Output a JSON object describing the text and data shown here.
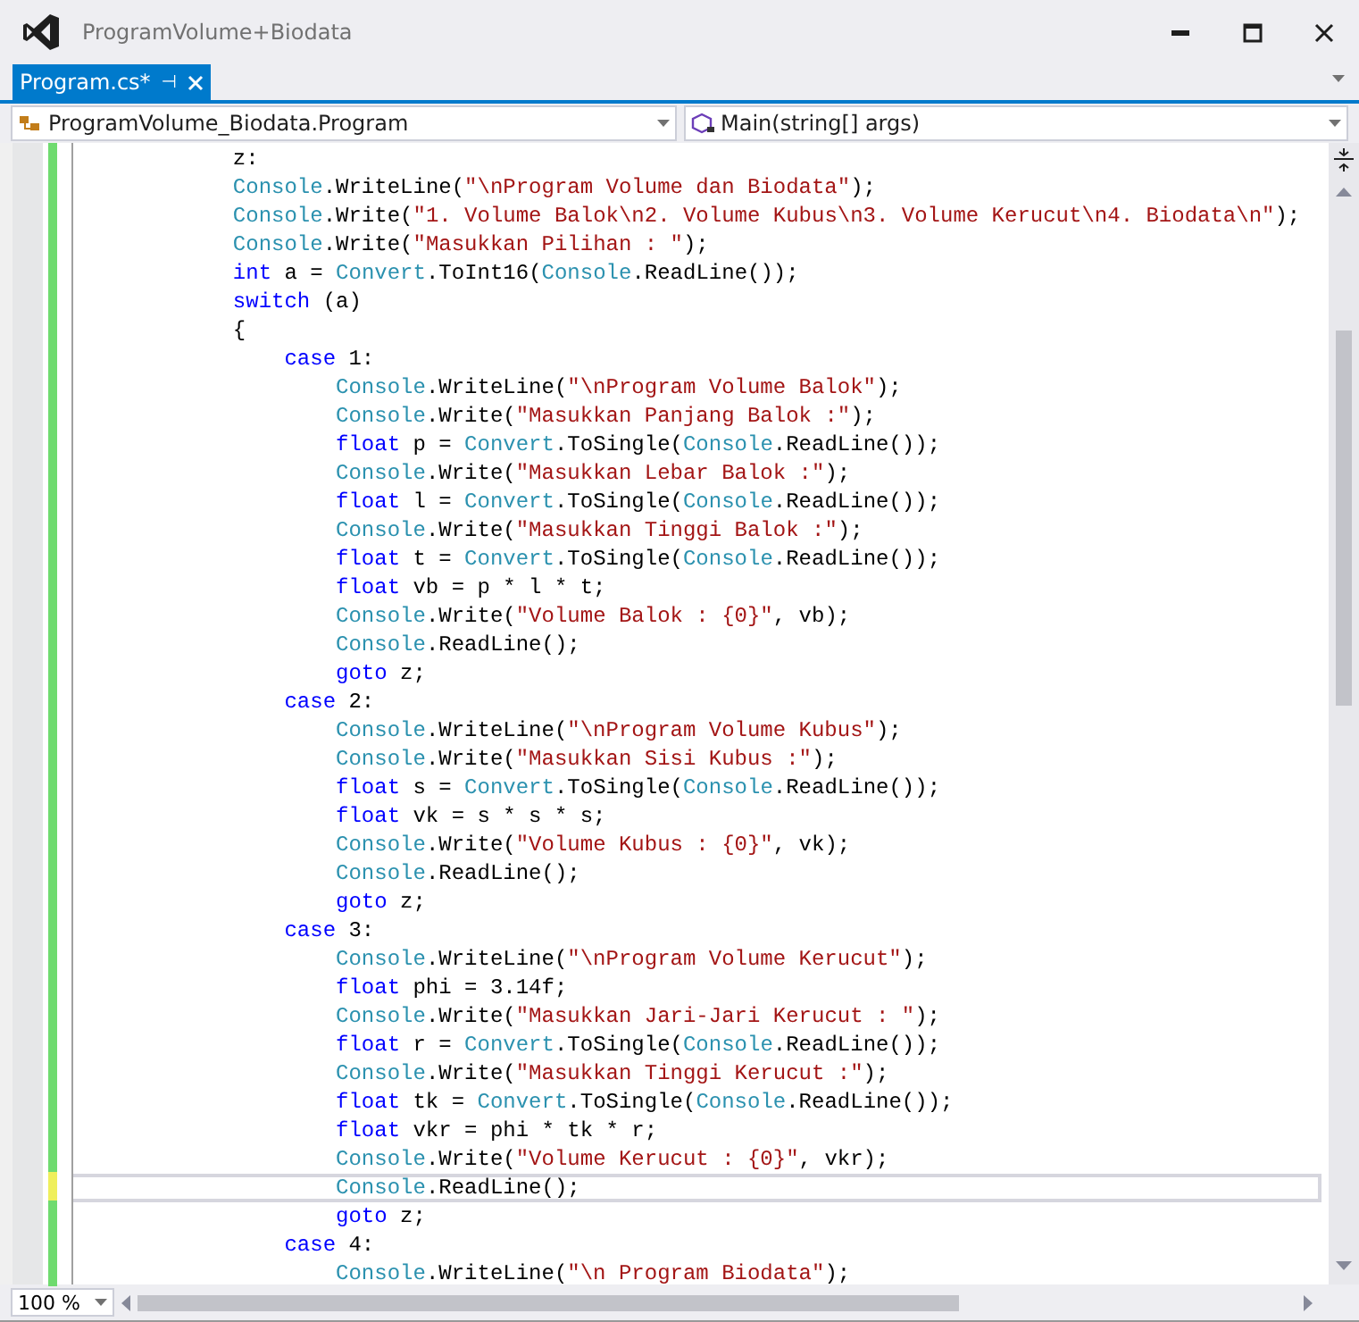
{
  "window": {
    "title": "ProgramVolume+Biodata"
  },
  "tabs": [
    {
      "label": "Program.cs*",
      "selected": true,
      "pin": "⊣"
    }
  ],
  "navigation": {
    "type_combo": "ProgramVolume_Biodata.Program",
    "member_combo": "Main(string[] args)"
  },
  "editor": {
    "lines": [
      {
        "saved": true,
        "current": false,
        "tokens": [
          {
            "kind": "plain",
            "text": "            z:"
          }
        ]
      },
      {
        "saved": true,
        "current": false,
        "tokens": [
          {
            "kind": "type",
            "text": "            Console"
          },
          {
            "kind": "plain",
            "text": ".WriteLine("
          },
          {
            "kind": "string",
            "text": "\"\\nProgram Volume dan Biodata\""
          },
          {
            "kind": "plain",
            "text": ");"
          }
        ]
      },
      {
        "saved": true,
        "current": false,
        "tokens": [
          {
            "kind": "type",
            "text": "            Console"
          },
          {
            "kind": "plain",
            "text": ".Write("
          },
          {
            "kind": "string",
            "text": "\"1. Volume Balok\\n2. Volume Kubus\\n3. Volume Kerucut\\n4. Biodata\\n\""
          },
          {
            "kind": "plain",
            "text": ");"
          }
        ]
      },
      {
        "saved": true,
        "current": false,
        "tokens": [
          {
            "kind": "type",
            "text": "            Console"
          },
          {
            "kind": "plain",
            "text": ".Write("
          },
          {
            "kind": "string",
            "text": "\"Masukkan Pilihan : \""
          },
          {
            "kind": "plain",
            "text": ");"
          }
        ]
      },
      {
        "saved": true,
        "current": false,
        "tokens": [
          {
            "kind": "keyword",
            "text": "            int"
          },
          {
            "kind": "plain",
            "text": " a = "
          },
          {
            "kind": "type",
            "text": "Convert"
          },
          {
            "kind": "plain",
            "text": ".ToInt16("
          },
          {
            "kind": "type",
            "text": "Console"
          },
          {
            "kind": "plain",
            "text": ".ReadLine());"
          }
        ]
      },
      {
        "saved": true,
        "current": false,
        "tokens": [
          {
            "kind": "keyword",
            "text": "            switch"
          },
          {
            "kind": "plain",
            "text": " (a)"
          }
        ]
      },
      {
        "saved": true,
        "current": false,
        "tokens": [
          {
            "kind": "plain",
            "text": "            {"
          }
        ]
      },
      {
        "saved": true,
        "current": false,
        "tokens": [
          {
            "kind": "keyword",
            "text": "                case"
          },
          {
            "kind": "plain",
            "text": " 1:"
          }
        ]
      },
      {
        "saved": true,
        "current": false,
        "tokens": [
          {
            "kind": "type",
            "text": "                    Console"
          },
          {
            "kind": "plain",
            "text": ".WriteLine("
          },
          {
            "kind": "string",
            "text": "\"\\nProgram Volume Balok\""
          },
          {
            "kind": "plain",
            "text": ");"
          }
        ]
      },
      {
        "saved": true,
        "current": false,
        "tokens": [
          {
            "kind": "type",
            "text": "                    Console"
          },
          {
            "kind": "plain",
            "text": ".Write("
          },
          {
            "kind": "string",
            "text": "\"Masukkan Panjang Balok :\""
          },
          {
            "kind": "plain",
            "text": ");"
          }
        ]
      },
      {
        "saved": true,
        "current": false,
        "tokens": [
          {
            "kind": "keyword",
            "text": "                    float"
          },
          {
            "kind": "plain",
            "text": " p = "
          },
          {
            "kind": "type",
            "text": "Convert"
          },
          {
            "kind": "plain",
            "text": ".ToSingle("
          },
          {
            "kind": "type",
            "text": "Console"
          },
          {
            "kind": "plain",
            "text": ".ReadLine());"
          }
        ]
      },
      {
        "saved": true,
        "current": false,
        "tokens": [
          {
            "kind": "type",
            "text": "                    Console"
          },
          {
            "kind": "plain",
            "text": ".Write("
          },
          {
            "kind": "string",
            "text": "\"Masukkan Lebar Balok :\""
          },
          {
            "kind": "plain",
            "text": ");"
          }
        ]
      },
      {
        "saved": true,
        "current": false,
        "tokens": [
          {
            "kind": "keyword",
            "text": "                    float"
          },
          {
            "kind": "plain",
            "text": " l = "
          },
          {
            "kind": "type",
            "text": "Convert"
          },
          {
            "kind": "plain",
            "text": ".ToSingle("
          },
          {
            "kind": "type",
            "text": "Console"
          },
          {
            "kind": "plain",
            "text": ".ReadLine());"
          }
        ]
      },
      {
        "saved": true,
        "current": false,
        "tokens": [
          {
            "kind": "type",
            "text": "                    Console"
          },
          {
            "kind": "plain",
            "text": ".Write("
          },
          {
            "kind": "string",
            "text": "\"Masukkan Tinggi Balok :\""
          },
          {
            "kind": "plain",
            "text": ");"
          }
        ]
      },
      {
        "saved": true,
        "current": false,
        "tokens": [
          {
            "kind": "keyword",
            "text": "                    float"
          },
          {
            "kind": "plain",
            "text": " t = "
          },
          {
            "kind": "type",
            "text": "Convert"
          },
          {
            "kind": "plain",
            "text": ".ToSingle("
          },
          {
            "kind": "type",
            "text": "Console"
          },
          {
            "kind": "plain",
            "text": ".ReadLine());"
          }
        ]
      },
      {
        "saved": true,
        "current": false,
        "tokens": [
          {
            "kind": "keyword",
            "text": "                    float"
          },
          {
            "kind": "plain",
            "text": " vb = p * l * t;"
          }
        ]
      },
      {
        "saved": true,
        "current": false,
        "tokens": [
          {
            "kind": "type",
            "text": "                    Console"
          },
          {
            "kind": "plain",
            "text": ".Write("
          },
          {
            "kind": "string",
            "text": "\"Volume Balok : {0}\""
          },
          {
            "kind": "plain",
            "text": ", vb);"
          }
        ]
      },
      {
        "saved": true,
        "current": false,
        "tokens": [
          {
            "kind": "type",
            "text": "                    Console"
          },
          {
            "kind": "plain",
            "text": ".ReadLine();"
          }
        ]
      },
      {
        "saved": true,
        "current": false,
        "tokens": [
          {
            "kind": "keyword",
            "text": "                    goto"
          },
          {
            "kind": "plain",
            "text": " z;"
          }
        ]
      },
      {
        "saved": true,
        "current": false,
        "tokens": [
          {
            "kind": "keyword",
            "text": "                case"
          },
          {
            "kind": "plain",
            "text": " 2:"
          }
        ]
      },
      {
        "saved": true,
        "current": false,
        "tokens": [
          {
            "kind": "type",
            "text": "                    Console"
          },
          {
            "kind": "plain",
            "text": ".WriteLine("
          },
          {
            "kind": "string",
            "text": "\"\\nProgram Volume Kubus\""
          },
          {
            "kind": "plain",
            "text": ");"
          }
        ]
      },
      {
        "saved": true,
        "current": false,
        "tokens": [
          {
            "kind": "type",
            "text": "                    Console"
          },
          {
            "kind": "plain",
            "text": ".Write("
          },
          {
            "kind": "string",
            "text": "\"Masukkan Sisi Kubus :\""
          },
          {
            "kind": "plain",
            "text": ");"
          }
        ]
      },
      {
        "saved": true,
        "current": false,
        "tokens": [
          {
            "kind": "keyword",
            "text": "                    float"
          },
          {
            "kind": "plain",
            "text": " s = "
          },
          {
            "kind": "type",
            "text": "Convert"
          },
          {
            "kind": "plain",
            "text": ".ToSingle("
          },
          {
            "kind": "type",
            "text": "Console"
          },
          {
            "kind": "plain",
            "text": ".ReadLine());"
          }
        ]
      },
      {
        "saved": true,
        "current": false,
        "tokens": [
          {
            "kind": "keyword",
            "text": "                    float"
          },
          {
            "kind": "plain",
            "text": " vk = s * s * s;"
          }
        ]
      },
      {
        "saved": true,
        "current": false,
        "tokens": [
          {
            "kind": "type",
            "text": "                    Console"
          },
          {
            "kind": "plain",
            "text": ".Write("
          },
          {
            "kind": "string",
            "text": "\"Volume Kubus : {0}\""
          },
          {
            "kind": "plain",
            "text": ", vk);"
          }
        ]
      },
      {
        "saved": true,
        "current": false,
        "tokens": [
          {
            "kind": "type",
            "text": "                    Console"
          },
          {
            "kind": "plain",
            "text": ".ReadLine();"
          }
        ]
      },
      {
        "saved": true,
        "current": false,
        "tokens": [
          {
            "kind": "keyword",
            "text": "                    goto"
          },
          {
            "kind": "plain",
            "text": " z;"
          }
        ]
      },
      {
        "saved": true,
        "current": false,
        "tokens": [
          {
            "kind": "keyword",
            "text": "                case"
          },
          {
            "kind": "plain",
            "text": " 3:"
          }
        ]
      },
      {
        "saved": true,
        "current": false,
        "tokens": [
          {
            "kind": "type",
            "text": "                    Console"
          },
          {
            "kind": "plain",
            "text": ".WriteLine("
          },
          {
            "kind": "string",
            "text": "\"\\nProgram Volume Kerucut\""
          },
          {
            "kind": "plain",
            "text": ");"
          }
        ]
      },
      {
        "saved": true,
        "current": false,
        "tokens": [
          {
            "kind": "keyword",
            "text": "                    float"
          },
          {
            "kind": "plain",
            "text": " phi = 3.14f;"
          }
        ]
      },
      {
        "saved": true,
        "current": false,
        "tokens": [
          {
            "kind": "type",
            "text": "                    Console"
          },
          {
            "kind": "plain",
            "text": ".Write("
          },
          {
            "kind": "string",
            "text": "\"Masukkan Jari-Jari Kerucut : \""
          },
          {
            "kind": "plain",
            "text": ");"
          }
        ]
      },
      {
        "saved": true,
        "current": false,
        "tokens": [
          {
            "kind": "keyword",
            "text": "                    float"
          },
          {
            "kind": "plain",
            "text": " r = "
          },
          {
            "kind": "type",
            "text": "Convert"
          },
          {
            "kind": "plain",
            "text": ".ToSingle("
          },
          {
            "kind": "type",
            "text": "Console"
          },
          {
            "kind": "plain",
            "text": ".ReadLine());"
          }
        ]
      },
      {
        "saved": true,
        "current": false,
        "tokens": [
          {
            "kind": "type",
            "text": "                    Console"
          },
          {
            "kind": "plain",
            "text": ".Write("
          },
          {
            "kind": "string",
            "text": "\"Masukkan Tinggi Kerucut :\""
          },
          {
            "kind": "plain",
            "text": ");"
          }
        ]
      },
      {
        "saved": true,
        "current": false,
        "tokens": [
          {
            "kind": "keyword",
            "text": "                    float"
          },
          {
            "kind": "plain",
            "text": " tk = "
          },
          {
            "kind": "type",
            "text": "Convert"
          },
          {
            "kind": "plain",
            "text": ".ToSingle("
          },
          {
            "kind": "type",
            "text": "Console"
          },
          {
            "kind": "plain",
            "text": ".ReadLine());"
          }
        ]
      },
      {
        "saved": true,
        "current": false,
        "tokens": [
          {
            "kind": "keyword",
            "text": "                    float"
          },
          {
            "kind": "plain",
            "text": " vkr = phi * tk * r;"
          }
        ]
      },
      {
        "saved": true,
        "current": false,
        "tokens": [
          {
            "kind": "type",
            "text": "                    Console"
          },
          {
            "kind": "plain",
            "text": ".Write("
          },
          {
            "kind": "string",
            "text": "\"Volume Kerucut : {0}\""
          },
          {
            "kind": "plain",
            "text": ", vkr);"
          }
        ]
      },
      {
        "saved": false,
        "current": true,
        "tokens": [
          {
            "kind": "type",
            "text": "                    Console"
          },
          {
            "kind": "plain",
            "text": ".ReadLine();"
          }
        ]
      },
      {
        "saved": true,
        "current": false,
        "tokens": [
          {
            "kind": "keyword",
            "text": "                    goto"
          },
          {
            "kind": "plain",
            "text": " z;"
          }
        ]
      },
      {
        "saved": true,
        "current": false,
        "tokens": [
          {
            "kind": "keyword",
            "text": "                case"
          },
          {
            "kind": "plain",
            "text": " 4:"
          }
        ]
      },
      {
        "saved": true,
        "current": false,
        "tokens": [
          {
            "kind": "type",
            "text": "                    Console"
          },
          {
            "kind": "plain",
            "text": ".WriteLine("
          },
          {
            "kind": "string",
            "text": "\"\\n Program Biodata\""
          },
          {
            "kind": "plain",
            "text": ");"
          }
        ]
      }
    ]
  },
  "zoom": {
    "value": "100 %"
  }
}
